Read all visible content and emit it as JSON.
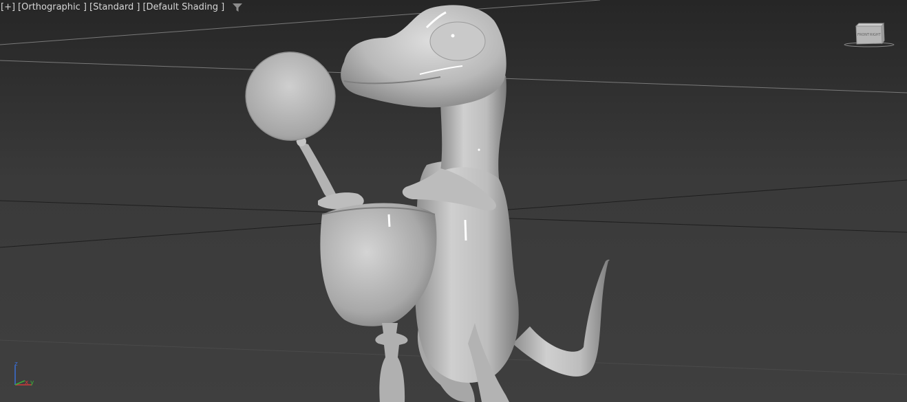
{
  "viewport": {
    "label": {
      "plus": "[+]",
      "view": "[Orthographic ]",
      "style": "[Standard ]",
      "shading": "[Default Shading ]"
    },
    "filter_icon": "funnel-icon",
    "viewcube": {
      "front": "FRONT",
      "right": "RIGHT"
    },
    "axes": {
      "x": "x",
      "y": "y",
      "z": "z",
      "x_color": "#d23a3a",
      "y_color": "#3ab13a",
      "z_color": "#3a6fd6"
    }
  },
  "scene": {
    "object": "cartoon dinosaur with wine glass and hand mirror (clay model)",
    "background_top": "#262626",
    "background_bottom": "#3f3f3f",
    "model_color": "#c4c4c4"
  }
}
